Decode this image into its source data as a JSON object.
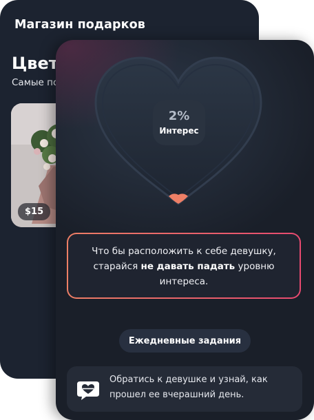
{
  "shop": {
    "title": "Магазин подарков",
    "heading": "Цветы",
    "subtitle": "Самые популярные",
    "product": {
      "price": "$15"
    }
  },
  "interest": {
    "value_text": "2%",
    "label": "Интерес",
    "level": 0.02,
    "hint_before": "Что бы расположить к себе девушку, старайся ",
    "hint_bold": "не давать падать",
    "hint_after": " уровню интереса.",
    "daily_button": "Ежедневные задания",
    "tip": "Обратись к девушке и узнай, как прошел ее вчерашний день.",
    "icon_name": "heart-chat-icon",
    "colors": {
      "fill": "#ee7f66",
      "gradient_start": "#ee7f66",
      "gradient_end": "#e84a70"
    }
  }
}
